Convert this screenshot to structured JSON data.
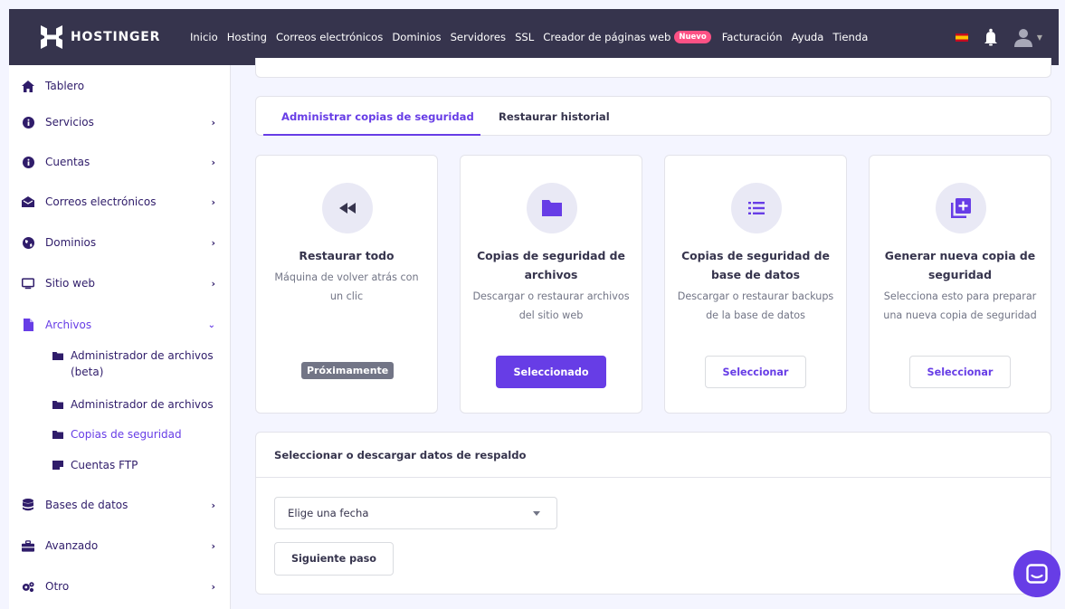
{
  "brand": {
    "name": "HOSTINGER"
  },
  "nav": {
    "items": [
      "Inicio",
      "Hosting",
      "Correos electrónicos",
      "Dominios",
      "Servidores",
      "SSL",
      "Creador de páginas web",
      "Facturación",
      "Ayuda",
      "Tienda"
    ],
    "new_badge": "Nuevo"
  },
  "sidebar": {
    "items": [
      {
        "label": "Tablero",
        "icon": "home-icon"
      },
      {
        "label": "Servicios",
        "icon": "info-icon"
      },
      {
        "label": "Cuentas",
        "icon": "info-icon"
      },
      {
        "label": "Correos electrónicos",
        "icon": "envelope-icon"
      },
      {
        "label": "Dominios",
        "icon": "globe-icon"
      },
      {
        "label": "Sitio web",
        "icon": "monitor-icon"
      },
      {
        "label": "Archivos",
        "icon": "file-icon"
      },
      {
        "label": "Bases de datos",
        "icon": "database-icon"
      },
      {
        "label": "Avanzado",
        "icon": "toolbox-icon"
      },
      {
        "label": "Otro",
        "icon": "gears-icon"
      }
    ],
    "sub_items": [
      {
        "label": "Administrador de archivos (beta)"
      },
      {
        "label": "Administrador de archivos"
      },
      {
        "label": "Copias de seguridad"
      },
      {
        "label": "Cuentas FTP"
      }
    ]
  },
  "tabs": [
    {
      "label": "Administrar copias de seguridad"
    },
    {
      "label": "Restaurar historial"
    }
  ],
  "options": [
    {
      "title": "Restaurar todo",
      "desc": "Máquina de volver atrás con un clic",
      "button": "Próximamente",
      "icon": "rewind-icon"
    },
    {
      "title": "Copias de seguridad de archivos",
      "desc": "Descargar o restaurar archivos del sitio web",
      "button": "Seleccionado",
      "icon": "folder-icon"
    },
    {
      "title": "Copias de seguridad de base de datos",
      "desc": "Descargar o restaurar backups de la base de datos",
      "button": "Seleccionar",
      "icon": "list-icon"
    },
    {
      "title": "Generar nueva copia de seguridad",
      "desc": "Selecciona esto para preparar una nueva copia de seguridad",
      "button": "Seleccionar",
      "icon": "add-copy-icon"
    }
  ],
  "download": {
    "title": "Seleccionar o descargar datos de respaldo",
    "select_value": "Elige una fecha",
    "next_button": "Siguiente paso"
  },
  "colors": {
    "primary": "#673de6",
    "topbar": "#36344d",
    "text": "#2f1c6a",
    "badge": "#fc5185"
  }
}
